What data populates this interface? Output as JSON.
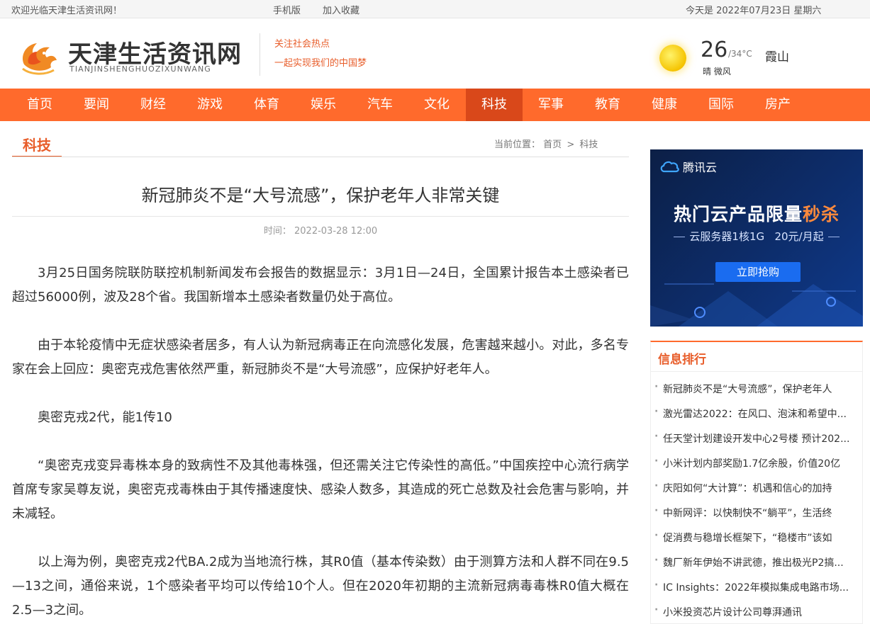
{
  "topbar": {
    "welcome": "欢迎光临天津生活资讯网！",
    "mobile": "手机版",
    "favorite": "加入收藏",
    "date": "今天是 2022年07月23日 星期六"
  },
  "header": {
    "site_name": "天津生活资讯网",
    "site_pinyin": "TIANJINSHENGHUOZIXUNWANG",
    "slogan1": "关注社会热点",
    "slogan2": "一起实现我们的中国梦",
    "weather": {
      "temp": "26",
      "temp_range": "/34°C",
      "desc": "晴 微风",
      "city": "霞山"
    }
  },
  "nav": {
    "items": [
      {
        "label": "首页"
      },
      {
        "label": "要闻"
      },
      {
        "label": "财经"
      },
      {
        "label": "游戏"
      },
      {
        "label": "体育"
      },
      {
        "label": "娱乐"
      },
      {
        "label": "汽车"
      },
      {
        "label": "文化"
      },
      {
        "label": "科技"
      },
      {
        "label": "军事"
      },
      {
        "label": "教育"
      },
      {
        "label": "健康"
      },
      {
        "label": "国际"
      },
      {
        "label": "房产"
      }
    ],
    "active": "科技"
  },
  "section": {
    "name": "科技",
    "breadcrumb_label": "当前位置：",
    "breadcrumb_home": "首页",
    "breadcrumb_sep": ">",
    "breadcrumb_current": "科技"
  },
  "article": {
    "title": "新冠肺炎不是“大号流感”，保护老年人非常关键",
    "time_label": "时间：",
    "time": "2022-03-28 12:00",
    "paragraphs": [
      "3月25日国务院联防联控机制新闻发布会报告的数据显示：3月1日—24日，全国累计报告本土感染者已超过56000例，波及28个省。我国新增本土感染者数量仍处于高位。",
      "由于本轮疫情中无症状感染者居多，有人认为新冠病毒正在向流感化发展，危害越来越小。对此，多名专家在会上回应：奥密克戎危害依然严重，新冠肺炎不是“大号流感”，应保护好老年人。",
      "奥密克戎2代，能1传10",
      "“奥密克戎变异毒株本身的致病性不及其他毒株强，但还需关注它传染性的高低。”中国疾控中心流行病学首席专家吴尊友说，奥密克戎毒株由于其传播速度快、感染人数多，其造成的死亡总数及社会危害与影响，并未减轻。",
      "以上海为例，奥密克戎2代BA.2成为当地流行株，其R0值（基本传染数）由于测算方法和人群不同在9.5—13之间，通俗来说，1个感染者平均可以传给10个人。但在2020年初期的主流新冠病毒毒株R0值大概在2.5—3之间。"
    ]
  },
  "ad": {
    "brand": "腾讯云",
    "headline_main": "热门云产品限量",
    "headline_highlight": "秒杀",
    "sub_left": "云服务器1核1G",
    "sub_right": "20元/月起",
    "button": "立即抢购",
    "accent_color": "#ff8a3c"
  },
  "ranking": {
    "title": "信息排行",
    "items": [
      "新冠肺炎不是“大号流感”，保护老年人",
      "激光雷达2022：在风口、泡沫和希望中...",
      "任天堂计划建设开发中心2号楼 预计202...",
      "小米计划内部奖励1.7亿余股，价值20亿",
      "庆阳如何“大计算”：机遇和信心的加持",
      "中新网评：以快制快不“躺平”，生活终",
      "促消费与稳增长框架下，“稳楼市”该如",
      "魏厂新年伊始不讲武德，推出极光P2搞...",
      "IC Insights：2022年模拟集成电路市场...",
      "小米投资芯片设计公司尊湃通讯"
    ]
  },
  "colors": {
    "brand_orange": "#ff6a2c",
    "nav_active": "#d9481a",
    "accent_text": "#e85d2a"
  }
}
